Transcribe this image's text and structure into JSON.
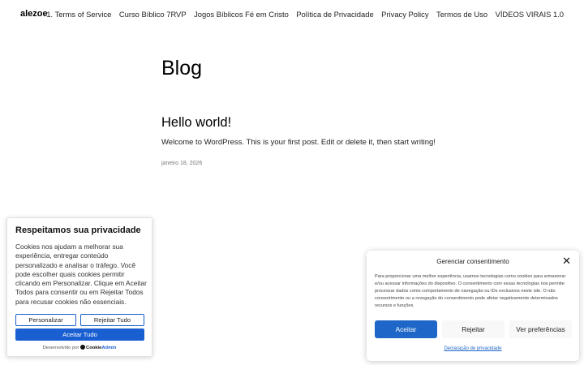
{
  "header": {
    "site_title": "alezoe",
    "nav": [
      "1. Terms of Service",
      "Curso Bíblico 7RVP",
      "Jogos Bíblicos Fé em Cristo",
      "Política de Privacidade",
      "Privacy Policy",
      "Termos de Uso",
      "VÍDEOS VIRAIS 1.0"
    ]
  },
  "main": {
    "page_title": "Blog",
    "post": {
      "title": "Hello world!",
      "excerpt": "Welcome to WordPress. This is your first post. Edit or delete it, then start writing!",
      "date": "janeiro 18, 2026"
    }
  },
  "cookie_left": {
    "title": "Respeitamos sua privacidade",
    "text": "Cookies nos ajudam a melhorar sua experiência, entregar conteúdo personalizado e analisar o tráfego. Você pode escolher quais cookies permitir clicando em Personalizar. Clique em Aceitar Todos para consentir ou em Rejeitar Todos para recusar cookies não essenciais.",
    "personalize_label": "Personalizar",
    "reject_label": "Rejeitar Tudo",
    "accept_label": "Aceitar Tudo",
    "powered_prefix": "Desenvolvido por",
    "brand_name": "Cookie",
    "brand_accent": "Admin"
  },
  "cookie_right": {
    "title": "Gerenciar consentimento",
    "text": "Para proporcionar uma melhor experiência, usamos tecnologias como cookies para armazenar e/ou acessar informações do dispositivo. O consentimento com essas tecnologias nos permite processar dados como comportamento de navegação ou IDs exclusivos neste site. O não consentimento ou a revogação do consentimento pode afetar negativamente determinados recursos e funções.",
    "accept_label": "Aceitar",
    "reject_label": "Rejeitar",
    "prefs_label": "Ver preferências",
    "link_label": "Declaração de privacidade",
    "close_glyph": "✕"
  },
  "colors": {
    "accent": "#1a5fd1",
    "accent_right": "#1e66c7"
  },
  "icons": {
    "close": "close-icon",
    "brand_logo": "cookieadmin-logo-icon"
  }
}
